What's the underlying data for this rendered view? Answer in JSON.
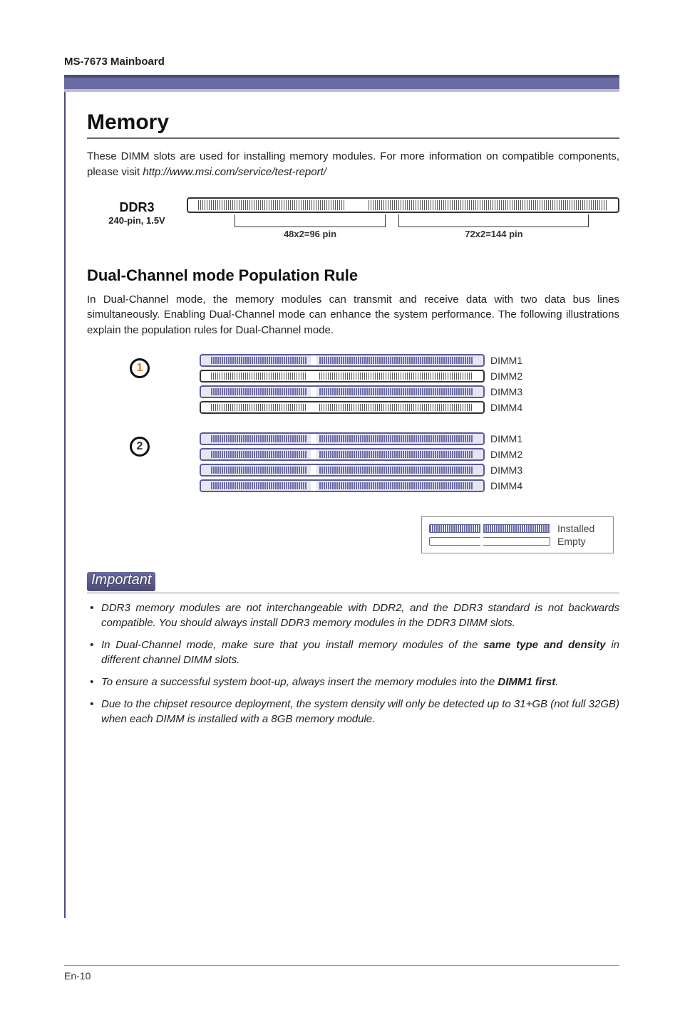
{
  "header": {
    "board": "MS-7673 Mainboard"
  },
  "section": {
    "title": "Memory",
    "intro_a": "These DIMM slots are used for installing memory modules. For more information on compatible components, please visit ",
    "intro_link": "http://www.msi.com/service/test-report/"
  },
  "ddr": {
    "name": "DDR3",
    "spec": "240-pin, 1.5V",
    "pin_left": "48x2=96 pin",
    "pin_right": "72x2=144  pin"
  },
  "dual_channel": {
    "title": "Dual-Channel mode Population Rule",
    "text": "In Dual-Channel mode, the memory modules can transmit and receive data with two data bus lines simultaneously. Enabling Dual-Channel mode can enhance the system performance. The following illustrations explain the population rules for Dual-Channel mode."
  },
  "population": {
    "configs": [
      {
        "badge": "1",
        "slots": [
          {
            "label": "DIMM1",
            "installed": true
          },
          {
            "label": "DIMM2",
            "installed": false
          },
          {
            "label": "DIMM3",
            "installed": true
          },
          {
            "label": "DIMM4",
            "installed": false
          }
        ]
      },
      {
        "badge": "2",
        "slots": [
          {
            "label": "DIMM1",
            "installed": true
          },
          {
            "label": "DIMM2",
            "installed": true
          },
          {
            "label": "DIMM3",
            "installed": true
          },
          {
            "label": "DIMM4",
            "installed": true
          }
        ]
      }
    ]
  },
  "legend": {
    "installed": "Installed",
    "empty": "Empty"
  },
  "important": {
    "heading": "Important",
    "notes": {
      "n1a": "DDR3 memory modules are not interchangeable with DDR2, and the DDR3 standard is not backwards compatible. You should always install DDR3 memory modules in the DDR3 DIMM slots.",
      "n2a": "In Dual-Channel mode, make sure that you install memory modules of the ",
      "n2b": "same type and density",
      "n2c": " in different channel DIMM slots.",
      "n3a": "To ensure a successful system boot-up, always insert the memory modules into the ",
      "n3b": "DIMM1 first",
      "n3c": ".",
      "n4a": "Due to the chipset resource deployment, the system density will only be detected up to 31+GB (not full 32GB) when each DIMM is installed with a 8GB memory module."
    }
  },
  "footer": {
    "page": "En-10"
  }
}
